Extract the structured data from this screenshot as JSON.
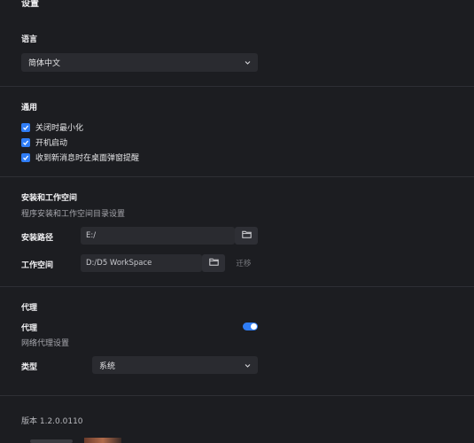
{
  "top_title": "设置",
  "language": {
    "heading": "语言",
    "selected": "简体中文"
  },
  "general": {
    "heading": "通用",
    "options": [
      {
        "label": "关闭时最小化",
        "checked": true
      },
      {
        "label": "开机启动",
        "checked": true
      },
      {
        "label": "收到新消息时在桌面弹窗提醒",
        "checked": true
      }
    ]
  },
  "install": {
    "heading": "安装和工作空间",
    "description": "程序安装和工作空间目录设置",
    "install_path_label": "安装路径",
    "install_path_value": "E:/",
    "workspace_label": "工作空间",
    "workspace_value": "D:/D5 WorkSpace",
    "migrate_label": "迁移"
  },
  "proxy": {
    "heading": "代理",
    "toggle_label": "代理",
    "toggle_on": true,
    "description": "网络代理设置",
    "type_label": "类型",
    "type_selected": "系统"
  },
  "version_text": "版本 1.2.0.0110",
  "colors": {
    "background": "#1c1d21",
    "accent": "#2f7df6",
    "field": "#2a2b30"
  }
}
